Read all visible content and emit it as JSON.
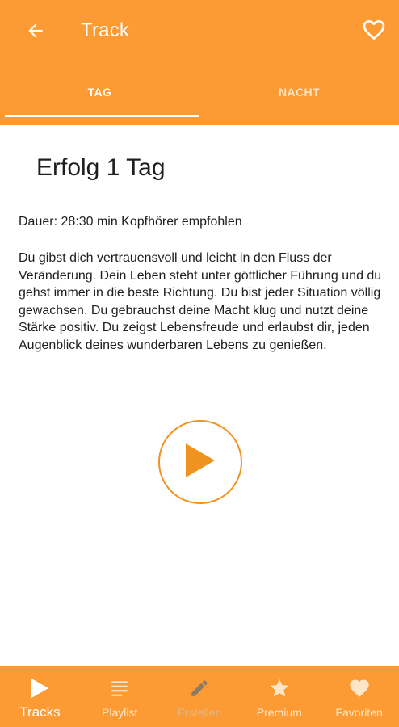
{
  "header": {
    "title": "Track",
    "back_icon": "arrow-left-icon",
    "favorite_icon": "heart-outline-icon"
  },
  "tabs": [
    {
      "label": "TAG",
      "active": true
    },
    {
      "label": "NACHT",
      "active": false
    }
  ],
  "track": {
    "title": "Erfolg 1 Tag",
    "meta": "Dauer: 28:30 min Kopfhörer empfohlen",
    "description": "Du gibst dich vertrauensvoll und leicht in den Fluss der Veränderung. Dein Leben steht unter göttlicher Führung und du gehst immer in die beste Richtung. Du bist jeder Situation völlig gewachsen. Du gebrauchst deine Macht klug und nutzt deine Stärke positiv. Du zeigst Lebensfreude und erlaubst dir, jeden Augenblick deines wunderbaren Lebens zu genießen.",
    "play_icon": "play-icon"
  },
  "bottom_nav": [
    {
      "label": "Tracks",
      "icon": "play-icon",
      "active": true
    },
    {
      "label": "Playlist",
      "icon": "list-icon",
      "active": false
    },
    {
      "label": "Erstellen",
      "icon": "pencil-icon",
      "active": false
    },
    {
      "label": "Premium",
      "icon": "star-icon",
      "active": false
    },
    {
      "label": "Favoriten",
      "icon": "heart-icon",
      "active": false
    }
  ],
  "colors": {
    "primary": "#fc9a33",
    "accent": "#f0921f",
    "text": "#1e1e1e",
    "background": "#ffffff"
  }
}
